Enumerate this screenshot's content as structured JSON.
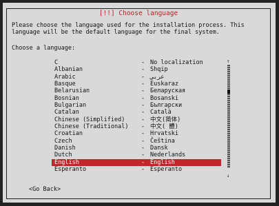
{
  "dialog": {
    "title": "[!!] Choose language",
    "intro_line1": "Please choose the language used for the installation process. This",
    "intro_line2": "language will be the default language for the final system.",
    "prompt": "Choose a language:",
    "go_back": "<Go Back>",
    "selected": "English"
  },
  "languages": [
    {
      "name": "C",
      "native": "No localization"
    },
    {
      "name": "Albanian",
      "native": "Shqip"
    },
    {
      "name": "Arabic",
      "native": "عربي"
    },
    {
      "name": "Basque",
      "native": "Euskaraz"
    },
    {
      "name": "Belarusian",
      "native": "Беларуская"
    },
    {
      "name": "Bosnian",
      "native": "Bosanski"
    },
    {
      "name": "Bulgarian",
      "native": "Български"
    },
    {
      "name": "Catalan",
      "native": "Català"
    },
    {
      "name": "Chinese (Simplified)",
      "native": "中文(简体)"
    },
    {
      "name": "Chinese (Traditional)",
      "native": "中文( 體)"
    },
    {
      "name": "Croatian",
      "native": "Hrvatski"
    },
    {
      "name": "Czech",
      "native": "Čeština"
    },
    {
      "name": "Danish",
      "native": "Dansk"
    },
    {
      "name": "Dutch",
      "native": "Nederlands"
    },
    {
      "name": "English",
      "native": "English"
    },
    {
      "name": "Esperanto",
      "native": "Esperanto"
    }
  ],
  "colors": {
    "background": "#d9d9d9",
    "title_text": "#c21f1f",
    "selection": "#c0262a"
  },
  "icons": {
    "scroll_up": "up-arrow",
    "scroll_down": "down-arrow"
  }
}
